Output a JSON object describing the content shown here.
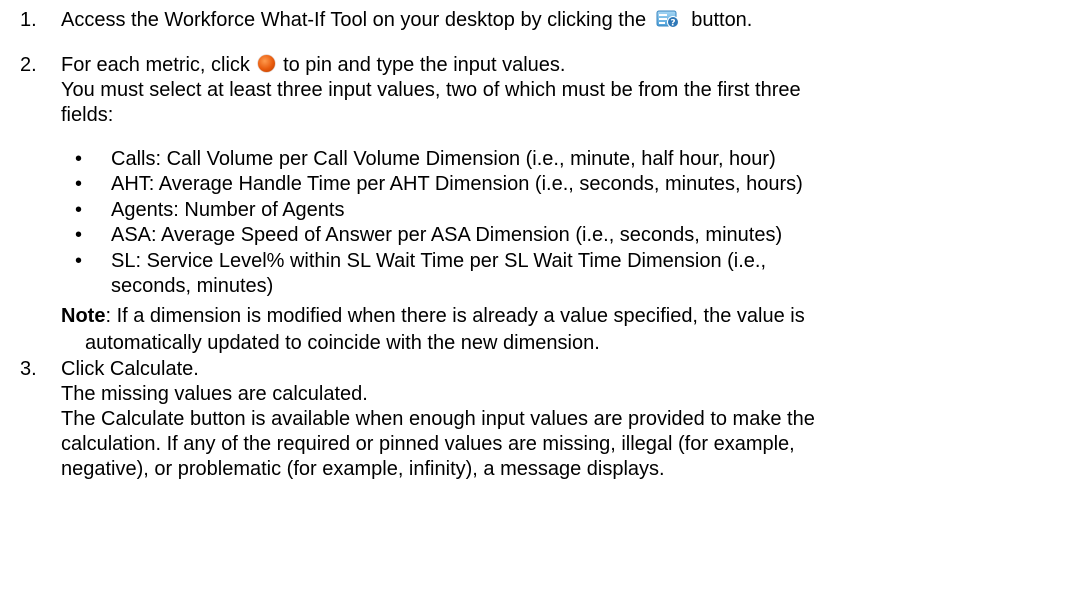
{
  "steps": [
    {
      "number": "1.",
      "lines": [
        "Access the Workforce What-If Tool on your desktop by clicking the",
        "button."
      ],
      "icon": "workforce-what-if-tool-icon"
    },
    {
      "number": "2.",
      "lines": [
        "For each metric, click",
        "to pin and type the input values.",
        "You must select at least three input values, two of which must be from the first three",
        "fields:"
      ],
      "icon": "pin-icon",
      "bullets": [
        "Calls: Call Volume per Call Volume Dimension (i.e., minute, half hour, hour)",
        "AHT: Average Handle Time per AHT Dimension (i.e., seconds, minutes, hours)",
        "Agents: Number of Agents",
        "ASA: Average Speed of Answer per ASA Dimension (i.e., seconds, minutes)",
        "SL: Service Level% within SL Wait Time per SL Wait Time Dimension (i.e.,",
        "seconds, minutes)"
      ],
      "note": {
        "label": "Note",
        "text_1": ": If a dimension is modified when there is already a value specified, the value is",
        "text_2": "automatically updated to coincide with the new dimension."
      }
    },
    {
      "number": "3.",
      "lines": [
        "Click Calculate.",
        "The missing values are calculated.",
        "The Calculate button is available when enough input values are provided to make the",
        "calculation. If any of the required or pinned values are missing, illegal (for example,",
        "negative), or problematic (for example, infinity), a message displays."
      ]
    }
  ],
  "bullet_glyph": "•"
}
